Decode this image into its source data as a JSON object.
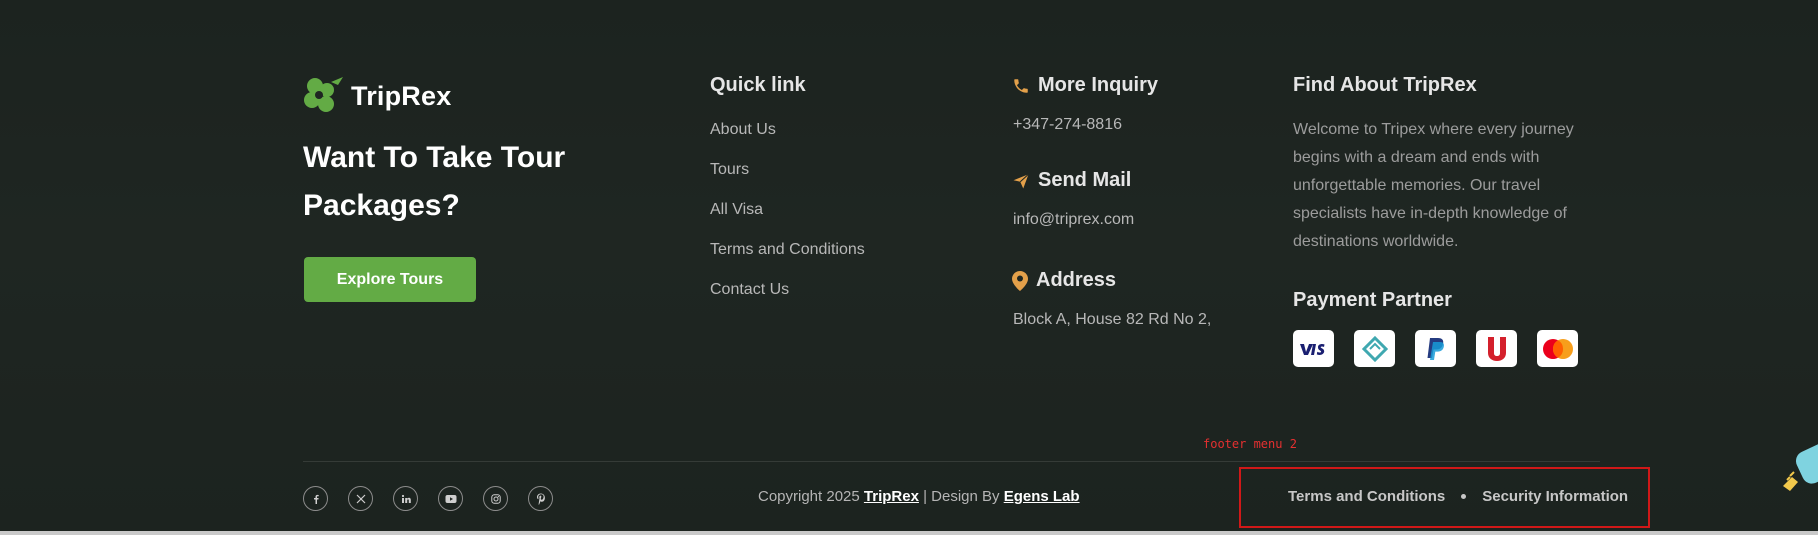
{
  "brand": {
    "name": "TripRex"
  },
  "hero": {
    "headline": "Want To Take Tour Packages?",
    "button_label": "Explore Tours"
  },
  "quick_links": {
    "title": "Quick link",
    "items": [
      "About Us",
      "Tours",
      "All Visa",
      "Terms and Conditions",
      "Contact Us"
    ]
  },
  "contact": {
    "inquiry_title": "More Inquiry",
    "phone": "+347-274-8816",
    "mail_title": "Send Mail",
    "email": "info@triprex.com",
    "address_title": "Address",
    "address": "Block A, House 82 Rd No 2,"
  },
  "about": {
    "title": "Find About TripRex",
    "text": "Welcome to Tripex where every journey begins with a dream and ends with unforgettable memories. Our travel specialists have in-depth knowledge of destinations worldwide."
  },
  "payment": {
    "title": "Payment Partner",
    "cards": [
      "visa-card-icon",
      "stripe-pattern-icon",
      "paypal-icon",
      "u-card-icon",
      "mastercard-icon"
    ]
  },
  "socials": [
    "facebook-icon",
    "x-icon",
    "linkedin-icon",
    "youtube-icon",
    "instagram-icon",
    "pinterest-icon"
  ],
  "copyright": {
    "prefix": "Copyright 2025 ",
    "brand": "TripRex",
    "middle": " | Design By ",
    "designer": "Egens Lab"
  },
  "footer_menu": {
    "label": "footer menu 2",
    "items": [
      "Terms and Conditions",
      "Security Information"
    ]
  },
  "colors": {
    "accent_green": "#63ab45",
    "icon_orange": "#e3a04a",
    "highlight_red": "#d01818",
    "background": "#1f2622"
  }
}
